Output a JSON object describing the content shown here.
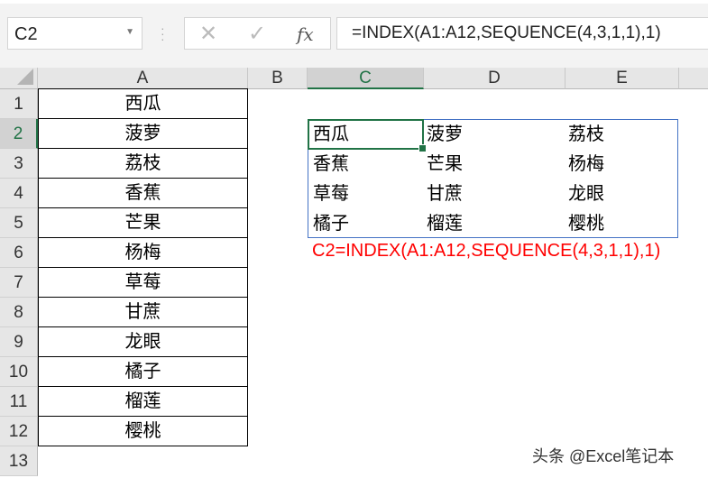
{
  "name_box": "C2",
  "formula_bar": {
    "cancel": "✕",
    "enter": "✓",
    "fx": "fx",
    "formula": "=INDEX(A1:A12,SEQUENCE(4,3,1,1),1)"
  },
  "columns": [
    "A",
    "B",
    "C",
    "D",
    "E"
  ],
  "rows": [
    "1",
    "2",
    "3",
    "4",
    "5",
    "6",
    "7",
    "8",
    "9",
    "10",
    "11",
    "12",
    "13"
  ],
  "column_a": [
    "西瓜",
    "菠萝",
    "荔枝",
    "香蕉",
    "芒果",
    "杨梅",
    "草莓",
    "甘蔗",
    "龙眼",
    "橘子",
    "榴莲",
    "樱桃"
  ],
  "spill": [
    [
      "西瓜",
      "菠萝",
      "荔枝"
    ],
    [
      "香蕉",
      "芒果",
      "杨梅"
    ],
    [
      "草莓",
      "甘蔗",
      "龙眼"
    ],
    [
      "橘子",
      "榴莲",
      "樱桃"
    ]
  ],
  "note": "C2=INDEX(A1:A12,SEQUENCE(4,3,1,1),1)",
  "watermark": "头条 @Excel笔记本"
}
